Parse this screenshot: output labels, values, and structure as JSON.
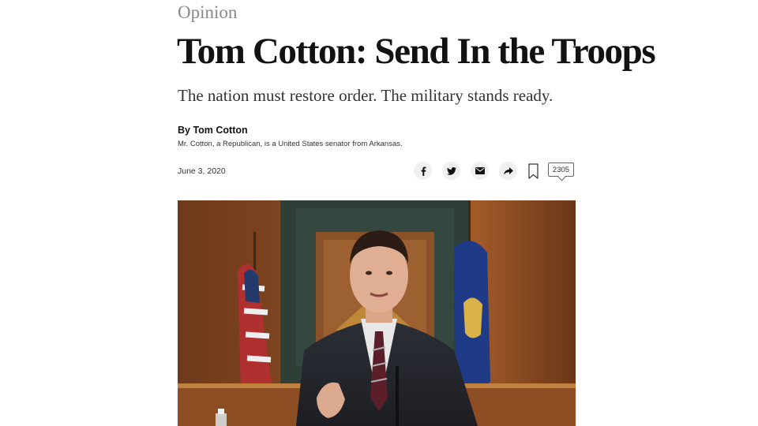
{
  "article": {
    "section": "Opinion",
    "headline": "Tom Cotton: Send In the Troops",
    "summary": "The nation must restore order. The military stands ready.",
    "byline": "By Tom Cotton",
    "author_bio": "Mr. Cotton, a Republican, is a United States senator from Arkansas.",
    "date": "June 3, 2020"
  },
  "share_tools": {
    "facebook_icon": "facebook-icon",
    "twitter_icon": "twitter-icon",
    "email_icon": "email-icon",
    "share_icon": "share-arrow-icon",
    "save_icon": "bookmark-icon",
    "comment_count": "2305"
  },
  "photo": {
    "subject": "man in dark suit and striped tie speaking at a hearing"
  }
}
